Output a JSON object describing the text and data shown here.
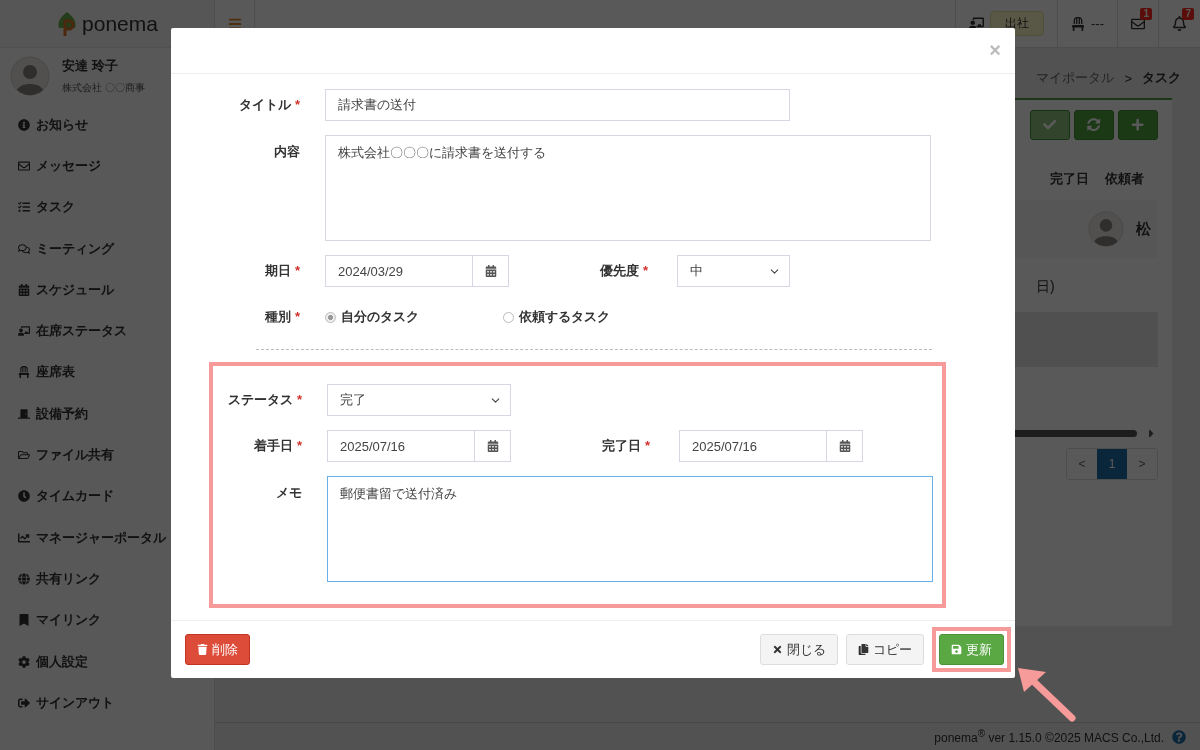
{
  "sidebar": {
    "logo": "ponema",
    "user": {
      "name": "安達 玲子",
      "company": "株式会社 〇〇商事"
    },
    "nav": [
      {
        "label": "お知らせ"
      },
      {
        "label": "メッセージ"
      },
      {
        "label": "タスク"
      },
      {
        "label": "ミーティング"
      },
      {
        "label": "スケジュール"
      },
      {
        "label": "在席ステータス"
      },
      {
        "label": "座席表"
      },
      {
        "label": "設備予約"
      },
      {
        "label": "ファイル共有"
      },
      {
        "label": "タイムカード"
      },
      {
        "label": "マネージャーポータル"
      },
      {
        "label": "共有リンク"
      },
      {
        "label": "マイリンク"
      },
      {
        "label": "個人設定"
      },
      {
        "label": "サインアウト"
      }
    ]
  },
  "header": {
    "presence": "出社",
    "seat": "---",
    "mail_count": "1",
    "notice_count": "7"
  },
  "main": {
    "breadcrumb": {
      "items": [
        "マイポータル",
        "タスク"
      ],
      "separator": ">"
    },
    "columns": [
      "完了日",
      "依頼者"
    ],
    "row": {
      "requester": "松"
    },
    "fragment": "日)",
    "pagination": {
      "prev": "<",
      "pages": [
        {
          "label": "1",
          "selected": true
        }
      ],
      "next": ">"
    },
    "footer": "ponema$^{®}$ ver 1.15.0 ©2025 MACS Co.,Ltd."
  },
  "modal": {
    "close": "×",
    "title_field": {
      "label": "タイトル",
      "required": "*",
      "value": "請求書の送付"
    },
    "content_field": {
      "label": "内容",
      "value": "株式会社〇〇〇に請求書を送付する"
    },
    "due_field": {
      "label": "期日",
      "required": "*",
      "value": "2024/03/29"
    },
    "priority_field": {
      "label": "優先度",
      "required": "*",
      "value": "中"
    },
    "type_field": {
      "label": "種別",
      "required": "*",
      "options": [
        {
          "label": "自分のタスク",
          "selected": true
        },
        {
          "label": "依頼するタスク",
          "selected": false
        }
      ]
    },
    "status_section": {
      "highlighted": true,
      "status_field": {
        "label": "ステータス",
        "required": "*",
        "value": "完了"
      },
      "start_field": {
        "label": "着手日",
        "required": "*",
        "value": "2025/07/16"
      },
      "end_field": {
        "label": "完了日",
        "required": "*",
        "value": "2025/07/16"
      },
      "memo_field": {
        "label": "メモ",
        "value": "郵便書留で送付済み",
        "focused": true
      }
    },
    "buttons": [
      {
        "kind": "delete",
        "label": "削除",
        "highlighted": false
      },
      {
        "kind": "close",
        "label": "閉じる",
        "highlighted": false
      },
      {
        "kind": "copy",
        "label": "コピー",
        "highlighted": false
      },
      {
        "kind": "save",
        "label": "更新",
        "highlighted": true
      }
    ]
  }
}
